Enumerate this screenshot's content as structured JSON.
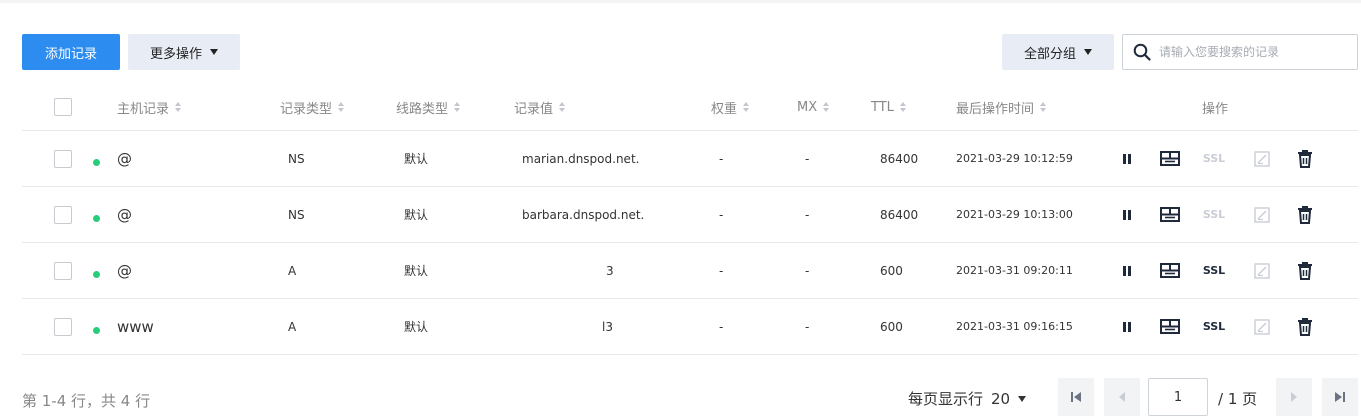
{
  "toolbar": {
    "add_record_label": "添加记录",
    "more_actions_label": "更多操作",
    "all_groups_label": "全部分组",
    "search_placeholder": "请输入您要搜索的记录"
  },
  "table": {
    "columns": {
      "host": "主机记录",
      "type": "记录类型",
      "line": "线路类型",
      "value": "记录值",
      "weight": "权重",
      "mx": "MX",
      "ttl": "TTL",
      "updated": "最后操作时间",
      "actions": "操作"
    },
    "rows": [
      {
        "host": "@",
        "type": "NS",
        "line": "默认",
        "value": "marian.dnspod.net.",
        "weight": "-",
        "mx": "-",
        "ttl": "86400",
        "updated": "2021-03-29 10:12:59",
        "ssl": "SSL",
        "ssl_enabled": false
      },
      {
        "host": "@",
        "type": "NS",
        "line": "默认",
        "value": "barbara.dnspod.net.",
        "weight": "-",
        "mx": "-",
        "ttl": "86400",
        "updated": "2021-03-29 10:13:00",
        "ssl": "SSL",
        "ssl_enabled": false
      },
      {
        "host": "@",
        "type": "A",
        "line": "默认",
        "value": "3",
        "weight": "-",
        "mx": "-",
        "ttl": "600",
        "updated": "2021-03-31 09:20:11",
        "ssl": "SSL",
        "ssl_enabled": true
      },
      {
        "host": "www",
        "type": "A",
        "line": "默认",
        "value": "l3",
        "weight": "-",
        "mx": "-",
        "ttl": "600",
        "updated": "2021-03-31 09:16:15",
        "ssl": "SSL",
        "ssl_enabled": true
      }
    ]
  },
  "pagination": {
    "summary": "第 1-4 行，共 4 行",
    "page_size_label": "每页显示行",
    "page_size": "20",
    "current_page": "1",
    "total_pages_label": "/ 1 页"
  },
  "colors": {
    "primary": "#2d8cf0",
    "status_enabled": "#29cc7a",
    "icon_dark": "#1f2a3c",
    "icon_disabled": "#c9ced6"
  }
}
